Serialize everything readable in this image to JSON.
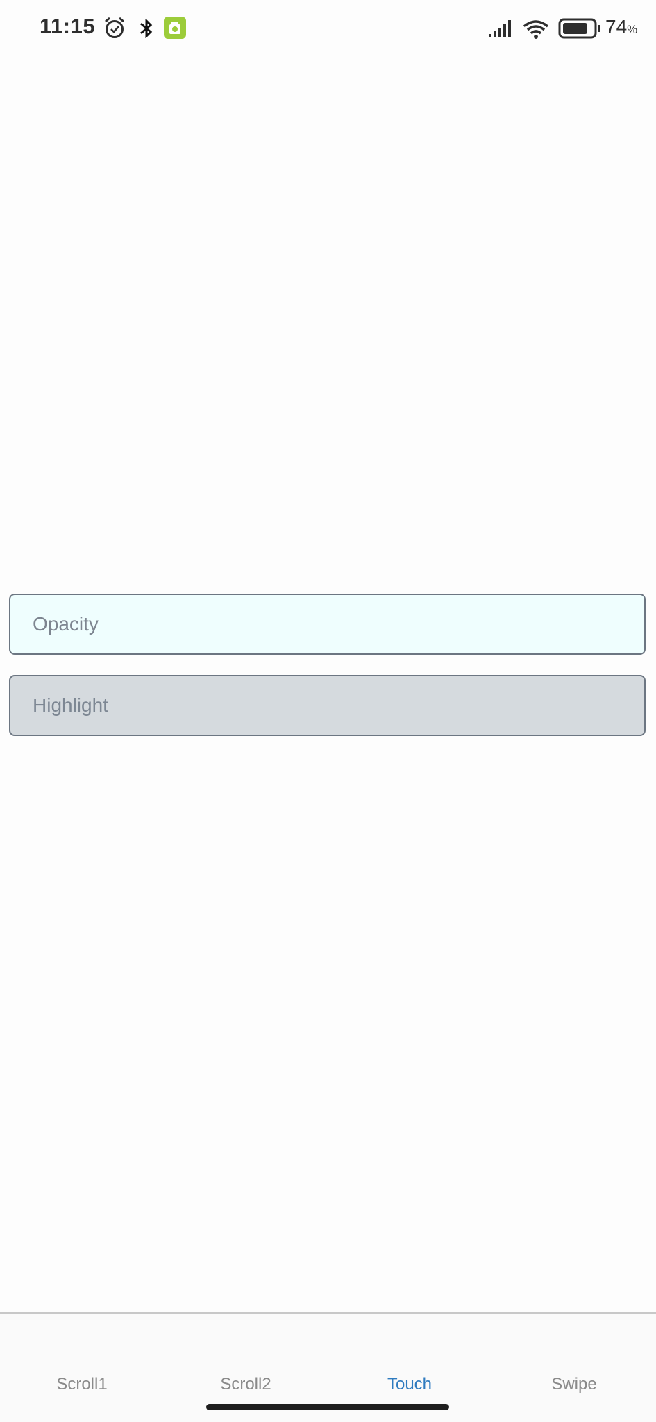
{
  "status_bar": {
    "time": "11:15",
    "battery_percent": "74",
    "battery_suffix": "%",
    "icons": [
      "alarm-icon",
      "bluetooth-icon",
      "android-app-icon",
      "signal-icon",
      "wifi-icon",
      "battery-icon"
    ],
    "android_icon_color": "#9ccc3a"
  },
  "buttons": {
    "opacity_label": "Opacity",
    "highlight_label": "Highlight"
  },
  "tabs": [
    {
      "label": "Scroll1",
      "active": false
    },
    {
      "label": "Scroll2",
      "active": false
    },
    {
      "label": "Touch",
      "active": true
    },
    {
      "label": "Swipe",
      "active": false
    }
  ],
  "colors": {
    "active_tab": "#2f7bbf",
    "inactive_tab": "#8a8a8a",
    "opacity_button_bg": "#effefe",
    "highlight_button_bg": "#d5dade"
  }
}
